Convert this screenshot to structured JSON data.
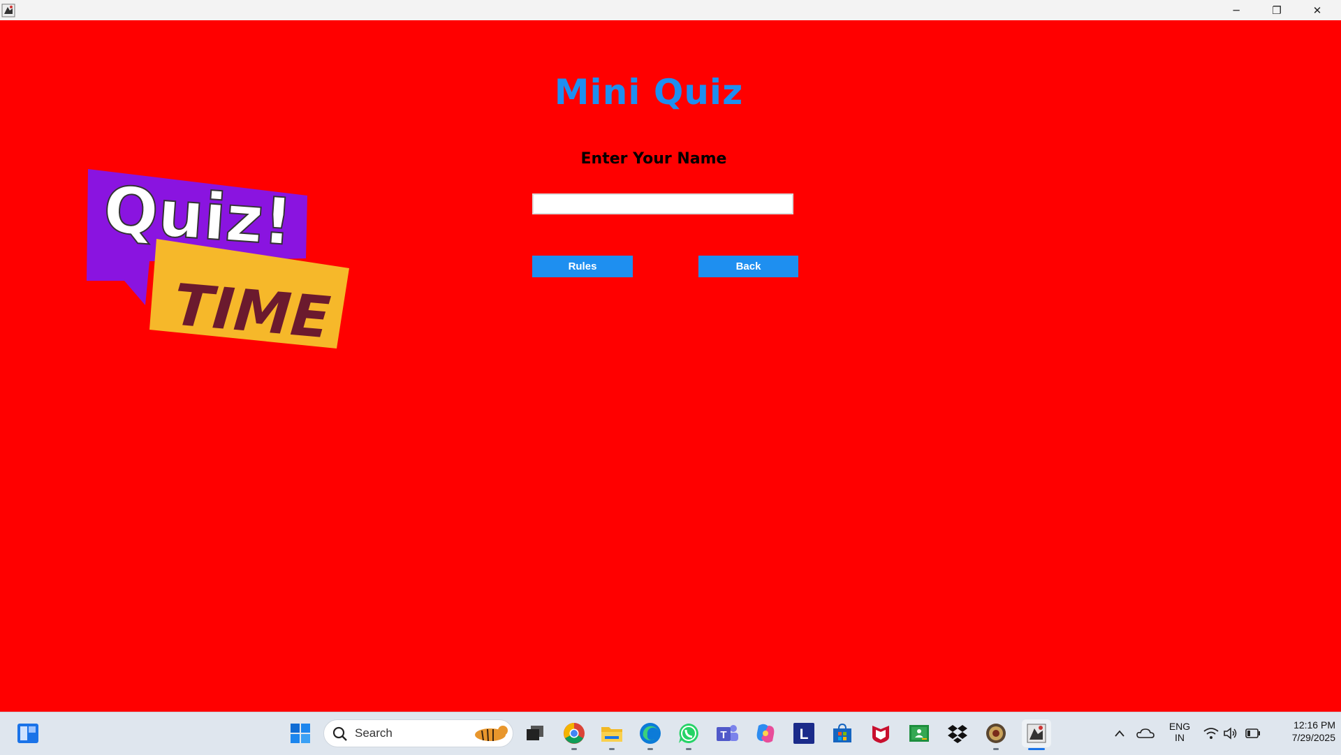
{
  "app": {
    "title": "Mini Quiz",
    "name_label": "Enter Your Name",
    "name_value": "",
    "rules_label": "Rules",
    "back_label": "Back",
    "logo_text_top": "Quiz!",
    "logo_text_bottom": "TIME"
  },
  "window_controls": {
    "minimize": "─",
    "maximize": "❐",
    "close": "✕"
  },
  "taskbar": {
    "search_label": "Search",
    "language": "ENG",
    "region": "IN",
    "time": "12:16 PM",
    "date": "7/29/2025",
    "icons": [
      "widgets-icon",
      "start-icon",
      "task-view-icon",
      "chrome-icon",
      "file-explorer-icon",
      "edge-icon",
      "whatsapp-icon",
      "teams-icon",
      "copilot-icon",
      "l-app-icon",
      "store-icon",
      "mcafee-icon",
      "classroom-icon",
      "dropbox-icon",
      "badge-app-icon",
      "java-app-icon"
    ]
  },
  "colors": {
    "background": "#ff0000",
    "title": "#1e8ff0",
    "button": "#1e8ff0",
    "logo_purple": "#8a14e0",
    "logo_yellow": "#f6b82a",
    "logo_maroon": "#6b1a2e"
  }
}
